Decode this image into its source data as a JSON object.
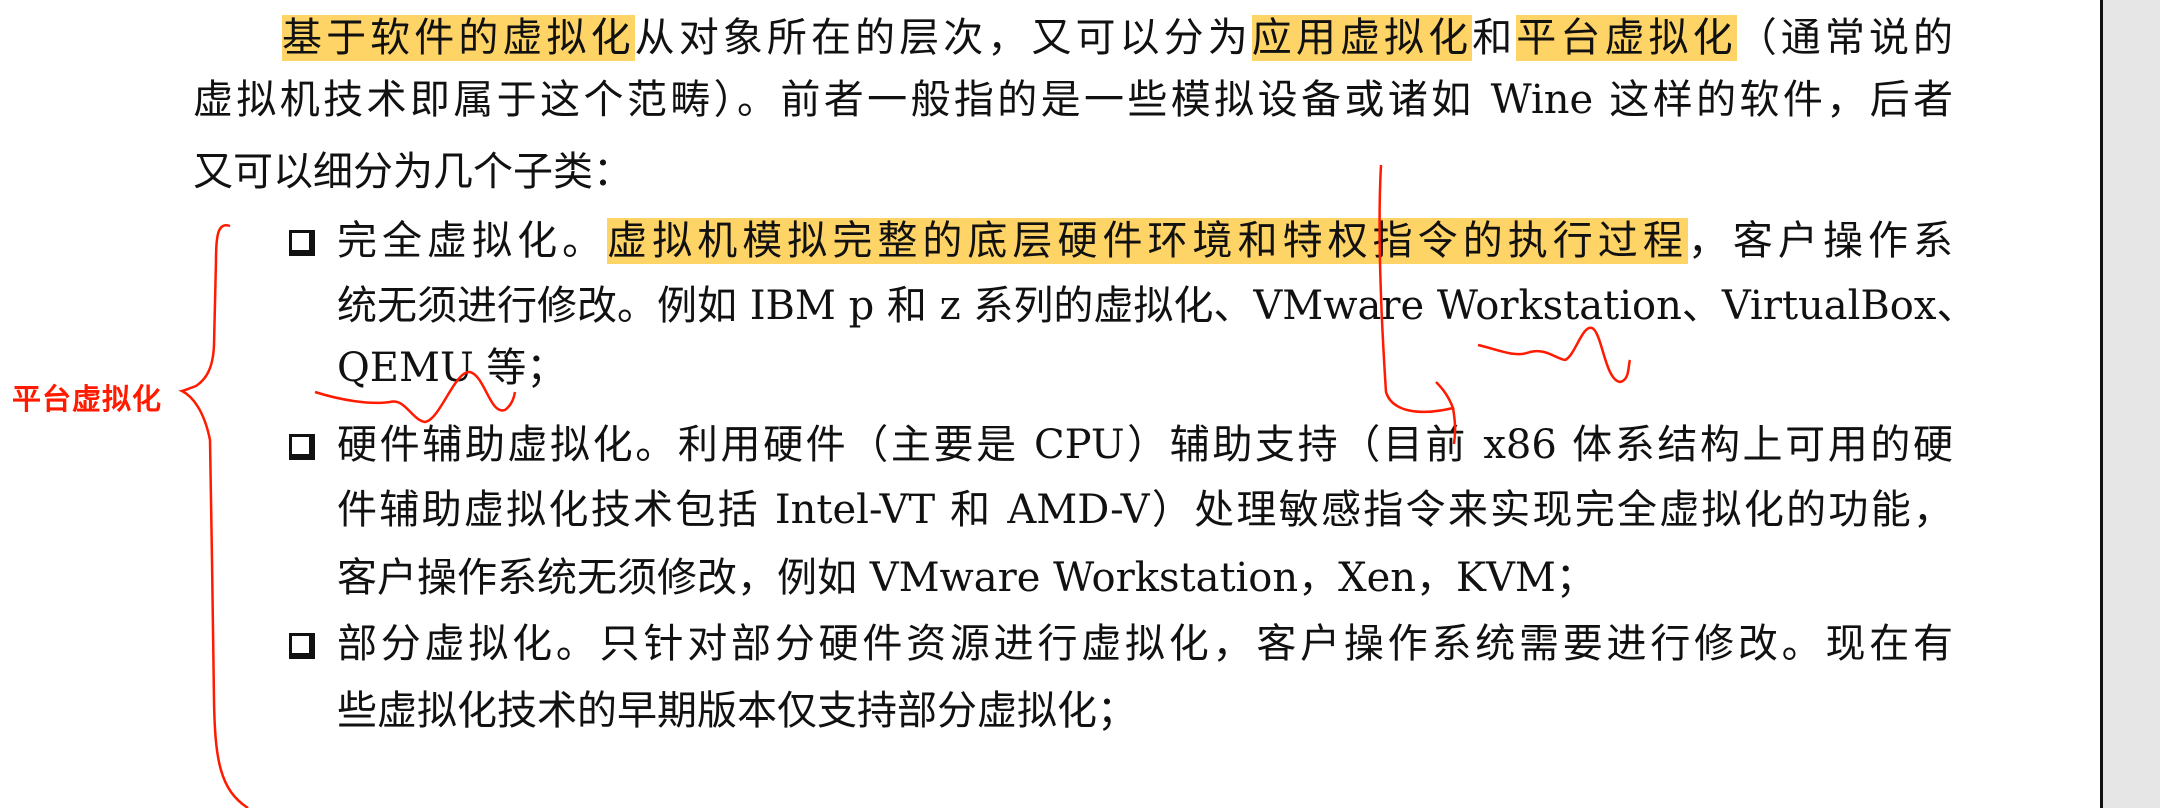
{
  "document": {
    "lines": [
      {
        "segments": [
          {
            "text": "基于软件的虚拟化",
            "highlight": true
          },
          {
            "text": "从对象所在的层次，又可以分为",
            "highlight": false
          },
          {
            "text": "应用虚拟化",
            "highlight": true
          },
          {
            "text": "和",
            "highlight": false
          },
          {
            "text": "平台虚拟化",
            "highlight": true
          },
          {
            "text": "（通常说的",
            "highlight": false
          }
        ]
      },
      {
        "segments": [
          {
            "text": "虚拟机技术即属于这个范畴）。前者一般指的是一些模拟设备或诸如 Wine 这样的软件，后者",
            "highlight": false
          }
        ]
      },
      {
        "segments": [
          {
            "text": "又可以细分为几个子类：",
            "highlight": false
          }
        ]
      },
      {
        "bullet": true,
        "segments": [
          {
            "text": "完全虚拟化。",
            "highlight": false
          },
          {
            "text": "虚拟机模拟完整的底层硬件环境和特权指令的执行过程",
            "highlight": true
          },
          {
            "text": "，客户操作系",
            "highlight": false
          }
        ]
      },
      {
        "segments": [
          {
            "text": "统无须进行修改。例如 IBM p 和 z 系列的虚拟化、VMware Workstation、VirtualBox、",
            "highlight": false
          }
        ]
      },
      {
        "segments": [
          {
            "text": "QEMU 等；",
            "highlight": false
          }
        ]
      },
      {
        "bullet": true,
        "segments": [
          {
            "text": "硬件辅助虚拟化。利用硬件（主要是 CPU）辅助支持（目前 x86 体系结构上可用的硬",
            "highlight": false
          }
        ]
      },
      {
        "segments": [
          {
            "text": "件辅助虚拟化技术包括 Intel-VT 和 AMD-V）处理敏感指令来实现完全虚拟化的功能，",
            "highlight": false
          }
        ]
      },
      {
        "segments": [
          {
            "text": "客户操作系统无须修改，例如 VMware Workstation，Xen，KVM；",
            "highlight": false
          }
        ]
      },
      {
        "bullet": true,
        "segments": [
          {
            "text": "部分虚拟化。只针对部分硬件资源进行虚拟化，客户操作系统需要进行修改。现在有",
            "highlight": false
          }
        ]
      },
      {
        "segments": [
          {
            "text": "些虚拟化技术的早期版本仅支持部分虚拟化；",
            "highlight": false
          }
        ]
      }
    ]
  },
  "annotation": {
    "label": "平台虚拟化",
    "color": "#ff1a00"
  },
  "colors": {
    "highlight": "#ffd466",
    "ink": "#111111",
    "sidebar": "#e6e6e6"
  }
}
